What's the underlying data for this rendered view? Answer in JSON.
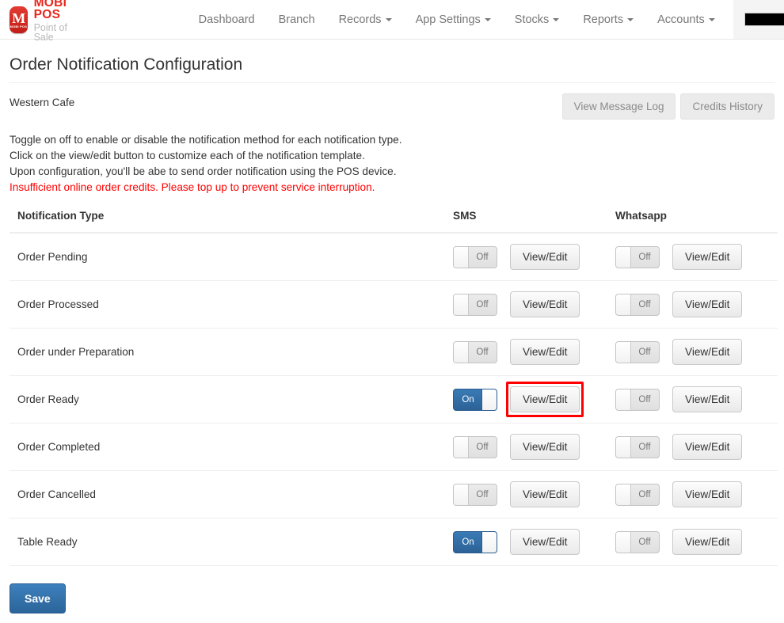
{
  "brand": {
    "logo_letter": "M",
    "logo_tiny": "MOBI POS",
    "name": "MOBI POS",
    "tagline": "Point of Sale"
  },
  "nav": {
    "items": [
      {
        "label": "Dashboard",
        "has_caret": false
      },
      {
        "label": "Branch",
        "has_caret": false
      },
      {
        "label": "Records",
        "has_caret": true
      },
      {
        "label": "App Settings",
        "has_caret": true
      },
      {
        "label": "Stocks",
        "has_caret": true
      },
      {
        "label": "Reports",
        "has_caret": true
      },
      {
        "label": "Accounts",
        "has_caret": true
      }
    ],
    "account": {
      "label": "",
      "redacted": true,
      "has_caret": true
    }
  },
  "page": {
    "title": "Order Notification Configuration",
    "store_name": "Western Cafe"
  },
  "top_buttons": {
    "view_message_log": "View Message Log",
    "credits_history": "Credits History"
  },
  "instructions": {
    "line1": "Toggle on off to enable or disable the notification method for each notification type.",
    "line2": "Click on the view/edit button to customize each of the notification template.",
    "line3": "Upon configuration, you'll be abe to send order notification using the POS device.",
    "warning": "Insufficient online order credits. Please top up to prevent service interruption.",
    "warning_color": "#ff0000"
  },
  "table": {
    "headers": {
      "type": "Notification Type",
      "sms": "SMS",
      "whatsapp": "Whatsapp"
    },
    "view_edit_label": "View/Edit",
    "toggle_on_label": "On",
    "toggle_off_label": "Off",
    "rows": [
      {
        "type": "Order Pending",
        "sms": "Off",
        "sms_highlight": false,
        "whatsapp": "Off"
      },
      {
        "type": "Order Processed",
        "sms": "Off",
        "sms_highlight": false,
        "whatsapp": "Off"
      },
      {
        "type": "Order under Preparation",
        "sms": "Off",
        "sms_highlight": false,
        "whatsapp": "Off"
      },
      {
        "type": "Order Ready",
        "sms": "On",
        "sms_highlight": true,
        "whatsapp": "Off"
      },
      {
        "type": "Order Completed",
        "sms": "Off",
        "sms_highlight": false,
        "whatsapp": "Off"
      },
      {
        "type": "Order Cancelled",
        "sms": "Off",
        "sms_highlight": false,
        "whatsapp": "Off"
      },
      {
        "type": "Table Ready",
        "sms": "On",
        "sms_highlight": false,
        "whatsapp": "Off"
      }
    ]
  },
  "footer": {
    "save_label": "Save"
  },
  "colors": {
    "brand_red": "#e8261c",
    "toggle_on_blue": "#2c6296",
    "save_blue": "#2b6499",
    "highlight_red": "#ff0000"
  }
}
